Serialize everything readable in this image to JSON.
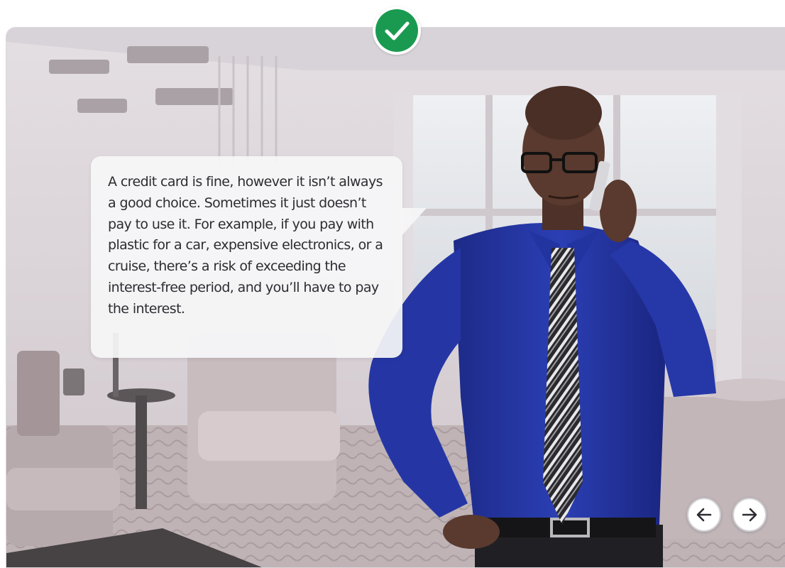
{
  "status": {
    "icon": "check-icon",
    "color": "#1a9a50"
  },
  "speech_bubble": {
    "text": "A credit card is fine, however it isn’t always a good choice. Sometimes it just doesn’t pay to use it. For example, if you pay with plastic for a car, expensive electronics, or a cruise, there’s a risk of exceeding the interest-free period, and you’ll have to pay the interest."
  },
  "navigation": {
    "prev": {
      "icon": "arrow-left-icon"
    },
    "next": {
      "icon": "arrow-right-icon"
    }
  }
}
